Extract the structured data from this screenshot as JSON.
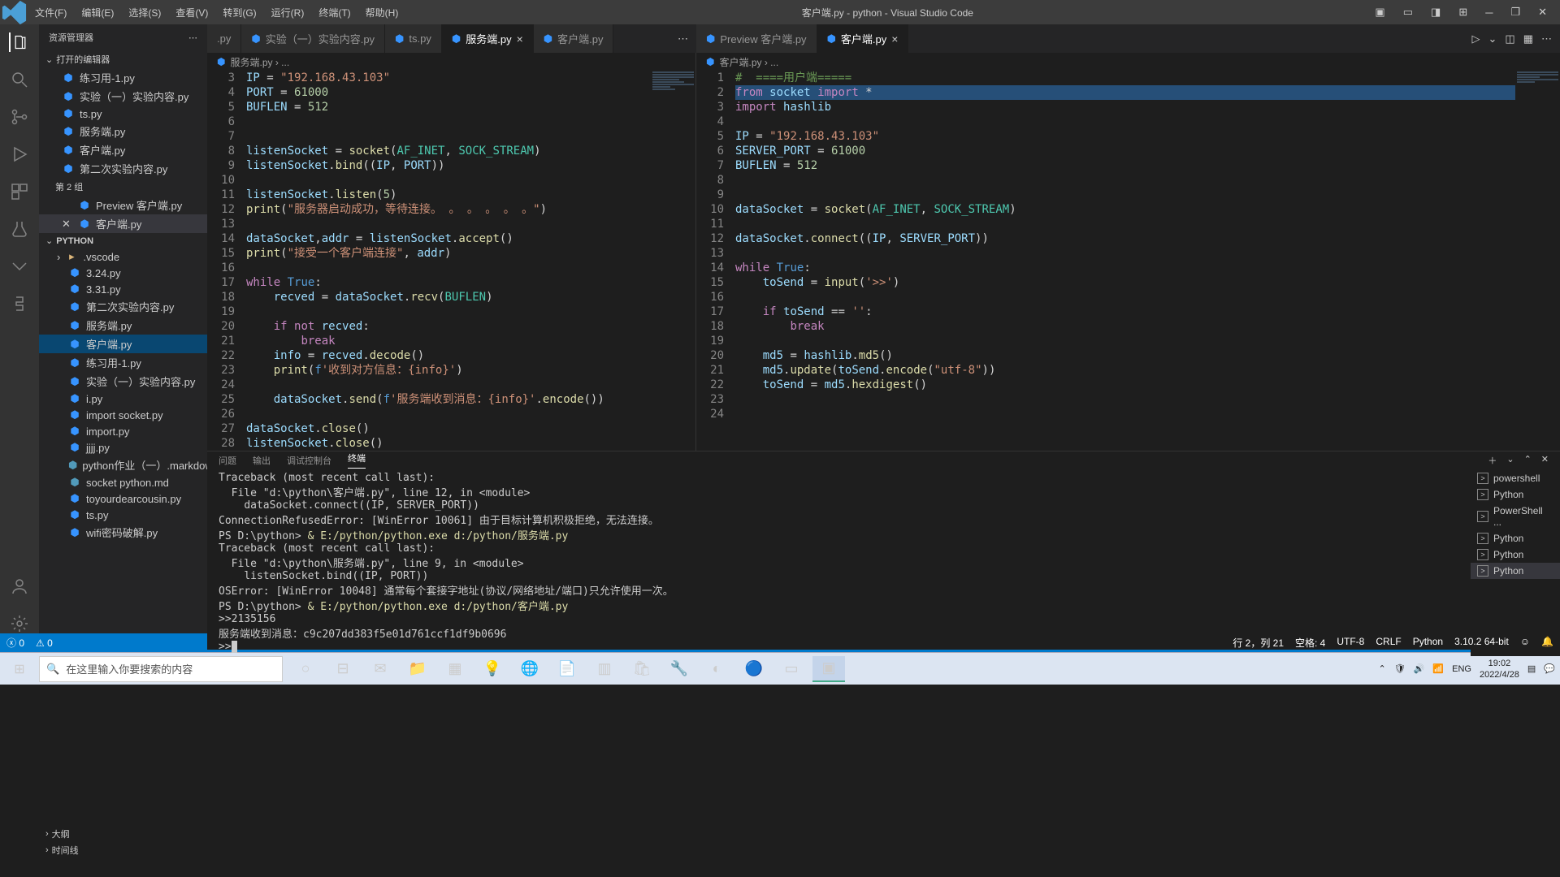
{
  "title": "客户端.py - python - Visual Studio Code",
  "menus": [
    "文件(F)",
    "编辑(E)",
    "选择(S)",
    "查看(V)",
    "转到(G)",
    "运行(R)",
    "终端(T)",
    "帮助(H)"
  ],
  "sidebar": {
    "title": "资源管理器",
    "openEditors": "打开的编辑器",
    "group2": "第 2 组",
    "pythonFolder": "PYTHON",
    "items": [
      {
        "label": "练习用-1.py",
        "active": false
      },
      {
        "label": "实验（一）实验内容.py",
        "active": false
      },
      {
        "label": "ts.py",
        "active": false
      },
      {
        "label": "服务端.py",
        "active": false
      },
      {
        "label": "客户端.py",
        "active": false
      },
      {
        "label": "第二次实验内容.py",
        "active": false
      }
    ],
    "group2items": [
      {
        "label": "Preview 客户端.py",
        "close": false
      },
      {
        "label": "客户端.py",
        "close": true,
        "active": true
      }
    ],
    "files": [
      ".vscode",
      "3.24.py",
      "3.31.py",
      "第二次实验内容.py",
      "服务端.py",
      "客户端.py",
      "练习用-1.py",
      "实验（一）实验内容.py",
      "i.py",
      "import socket.py",
      "import.py",
      "jjjj.py",
      "python作业（一）.markdown",
      "socket python.md",
      "toyourdearcousin.py",
      "ts.py",
      "wifi密码破解.py"
    ],
    "outline": "大纲",
    "timeline": "时间线"
  },
  "tabsLeft": [
    {
      "label": ".py",
      "dot": false,
      "active": false
    },
    {
      "label": "实验（一）实验内容.py",
      "dot": true,
      "active": false
    },
    {
      "label": "ts.py",
      "dot": true,
      "active": false
    },
    {
      "label": "服务端.py",
      "dot": true,
      "active": true,
      "close": true
    },
    {
      "label": "客户端.py",
      "dot": true,
      "active": false
    }
  ],
  "tabsRight": [
    {
      "label": "Preview 客户端.py",
      "dot": true,
      "active": false
    },
    {
      "label": "客户端.py",
      "dot": true,
      "active": true,
      "close": true
    }
  ],
  "breadcrumbLeft": "服务端.py › ...",
  "breadcrumbRight": "客户端.py › ...",
  "codeLeft": {
    "start": 3,
    "lines": [
      [
        [
          "var",
          "IP"
        ],
        [
          "op",
          " = "
        ],
        [
          "str",
          "\"192.168.43.103\""
        ]
      ],
      [
        [
          "var",
          "PORT"
        ],
        [
          "op",
          " = "
        ],
        [
          "num",
          "61000"
        ]
      ],
      [
        [
          "var",
          "BUFLEN"
        ],
        [
          "op",
          " = "
        ],
        [
          "num",
          "512"
        ]
      ],
      [],
      [],
      [
        [
          "var",
          "listenSocket"
        ],
        [
          "op",
          " = "
        ],
        [
          "fn",
          "socket"
        ],
        [
          "op",
          "("
        ],
        [
          "cls",
          "AF_INET"
        ],
        [
          "op",
          ", "
        ],
        [
          "cls",
          "SOCK_STREAM"
        ],
        [
          "op",
          ")"
        ]
      ],
      [
        [
          "var",
          "listenSocket"
        ],
        [
          "op",
          "."
        ],
        [
          "fn",
          "bind"
        ],
        [
          "op",
          "(("
        ],
        [
          "var",
          "IP"
        ],
        [
          "op",
          ", "
        ],
        [
          "var",
          "PORT"
        ],
        [
          "op",
          "))"
        ]
      ],
      [],
      [
        [
          "var",
          "listenSocket"
        ],
        [
          "op",
          "."
        ],
        [
          "fn",
          "listen"
        ],
        [
          "op",
          "("
        ],
        [
          "num",
          "5"
        ],
        [
          "op",
          ")"
        ]
      ],
      [
        [
          "fn",
          "print"
        ],
        [
          "op",
          "("
        ],
        [
          "str",
          "\"服务器启动成功，等待连接。 。 。 。 。 。\""
        ],
        [
          "op",
          ")"
        ]
      ],
      [],
      [
        [
          "var",
          "dataSocket"
        ],
        [
          "op",
          ","
        ],
        [
          "var",
          "addr"
        ],
        [
          "op",
          " = "
        ],
        [
          "var",
          "listenSocket"
        ],
        [
          "op",
          "."
        ],
        [
          "fn",
          "accept"
        ],
        [
          "op",
          "()"
        ]
      ],
      [
        [
          "fn",
          "print"
        ],
        [
          "op",
          "("
        ],
        [
          "str",
          "\"接受一个客户端连接\""
        ],
        [
          "op",
          ", "
        ],
        [
          "var",
          "addr"
        ],
        [
          "op",
          ")"
        ]
      ],
      [],
      [
        [
          "kw",
          "while"
        ],
        [
          "op",
          " "
        ],
        [
          "const",
          "True"
        ],
        [
          "op",
          ":"
        ]
      ],
      [
        [
          "op",
          "    "
        ],
        [
          "var",
          "recved"
        ],
        [
          "op",
          " = "
        ],
        [
          "var",
          "dataSocket"
        ],
        [
          "op",
          "."
        ],
        [
          "fn",
          "recv"
        ],
        [
          "op",
          "("
        ],
        [
          "cls",
          "BUFLEN"
        ],
        [
          "op",
          ")"
        ]
      ],
      [],
      [
        [
          "op",
          "    "
        ],
        [
          "kw",
          "if"
        ],
        [
          "op",
          " "
        ],
        [
          "kw",
          "not"
        ],
        [
          "op",
          " "
        ],
        [
          "var",
          "recved"
        ],
        [
          "op",
          ":"
        ]
      ],
      [
        [
          "op",
          "        "
        ],
        [
          "kw",
          "break"
        ]
      ],
      [
        [
          "op",
          "    "
        ],
        [
          "var",
          "info"
        ],
        [
          "op",
          " = "
        ],
        [
          "var",
          "recved"
        ],
        [
          "op",
          "."
        ],
        [
          "fn",
          "decode"
        ],
        [
          "op",
          "()"
        ]
      ],
      [
        [
          "op",
          "    "
        ],
        [
          "fn",
          "print"
        ],
        [
          "op",
          "("
        ],
        [
          "const",
          "f"
        ],
        [
          "str",
          "'收到对方信息：{info}'"
        ],
        [
          "op",
          ")"
        ]
      ],
      [],
      [
        [
          "op",
          "    "
        ],
        [
          "var",
          "dataSocket"
        ],
        [
          "op",
          "."
        ],
        [
          "fn",
          "send"
        ],
        [
          "op",
          "("
        ],
        [
          "const",
          "f"
        ],
        [
          "str",
          "'服务端收到消息：{info}'"
        ],
        [
          "op",
          "."
        ],
        [
          "fn",
          "encode"
        ],
        [
          "op",
          "())"
        ]
      ],
      [],
      [
        [
          "var",
          "dataSocket"
        ],
        [
          "op",
          "."
        ],
        [
          "fn",
          "close"
        ],
        [
          "op",
          "()"
        ]
      ],
      [
        [
          "var",
          "listenSocket"
        ],
        [
          "op",
          "."
        ],
        [
          "fn",
          "close"
        ],
        [
          "op",
          "()"
        ]
      ]
    ]
  },
  "codeRight": {
    "start": 1,
    "lines": [
      [
        [
          "com",
          "#  ====用户端====="
        ]
      ],
      [
        [
          "kw",
          "from"
        ],
        [
          "op",
          " "
        ],
        [
          "var",
          "socket"
        ],
        [
          "op",
          " "
        ],
        [
          "kw",
          "import"
        ],
        [
          "op",
          " *"
        ]
      ],
      [
        [
          "kw",
          "import"
        ],
        [
          "op",
          " "
        ],
        [
          "var",
          "hashlib"
        ]
      ],
      [],
      [
        [
          "var",
          "IP"
        ],
        [
          "op",
          " = "
        ],
        [
          "str",
          "\"192.168.43.103\""
        ]
      ],
      [
        [
          "var",
          "SERVER_PORT"
        ],
        [
          "op",
          " = "
        ],
        [
          "num",
          "61000"
        ]
      ],
      [
        [
          "var",
          "BUFLEN"
        ],
        [
          "op",
          " = "
        ],
        [
          "num",
          "512"
        ]
      ],
      [],
      [],
      [
        [
          "var",
          "dataSocket"
        ],
        [
          "op",
          " = "
        ],
        [
          "fn",
          "socket"
        ],
        [
          "op",
          "("
        ],
        [
          "cls",
          "AF_INET"
        ],
        [
          "op",
          ", "
        ],
        [
          "cls",
          "SOCK_STREAM"
        ],
        [
          "op",
          ")"
        ]
      ],
      [],
      [
        [
          "var",
          "dataSocket"
        ],
        [
          "op",
          "."
        ],
        [
          "fn",
          "connect"
        ],
        [
          "op",
          "(("
        ],
        [
          "var",
          "IP"
        ],
        [
          "op",
          ", "
        ],
        [
          "var",
          "SERVER_PORT"
        ],
        [
          "op",
          "))"
        ]
      ],
      [],
      [
        [
          "kw",
          "while"
        ],
        [
          "op",
          " "
        ],
        [
          "const",
          "True"
        ],
        [
          "op",
          ":"
        ]
      ],
      [
        [
          "op",
          "    "
        ],
        [
          "var",
          "toSend"
        ],
        [
          "op",
          " = "
        ],
        [
          "fn",
          "input"
        ],
        [
          "op",
          "("
        ],
        [
          "str",
          "'>>'"
        ],
        [
          "op",
          ")"
        ]
      ],
      [],
      [
        [
          "op",
          "    "
        ],
        [
          "kw",
          "if"
        ],
        [
          "op",
          " "
        ],
        [
          "var",
          "toSend"
        ],
        [
          "op",
          " == "
        ],
        [
          "str",
          "''"
        ],
        [
          "op",
          ":"
        ]
      ],
      [
        [
          "op",
          "        "
        ],
        [
          "kw",
          "break"
        ]
      ],
      [],
      [
        [
          "op",
          "    "
        ],
        [
          "var",
          "md5"
        ],
        [
          "op",
          " = "
        ],
        [
          "var",
          "hashlib"
        ],
        [
          "op",
          "."
        ],
        [
          "fn",
          "md5"
        ],
        [
          "op",
          "()"
        ]
      ],
      [
        [
          "op",
          "    "
        ],
        [
          "var",
          "md5"
        ],
        [
          "op",
          "."
        ],
        [
          "fn",
          "update"
        ],
        [
          "op",
          "("
        ],
        [
          "var",
          "toSend"
        ],
        [
          "op",
          "."
        ],
        [
          "fn",
          "encode"
        ],
        [
          "op",
          "("
        ],
        [
          "str",
          "\"utf-8\""
        ],
        [
          "op",
          "))"
        ]
      ],
      [
        [
          "op",
          "    "
        ],
        [
          "var",
          "toSend"
        ],
        [
          "op",
          " = "
        ],
        [
          "var",
          "md5"
        ],
        [
          "op",
          "."
        ],
        [
          "fn",
          "hexdigest"
        ],
        [
          "op",
          "()"
        ]
      ],
      [],
      []
    ],
    "highlightLine": 2
  },
  "panelTabs": [
    "问题",
    "输出",
    "调试控制台",
    "终端"
  ],
  "panelActive": 3,
  "terminal": [
    {
      "t": "Traceback (most recent call last):"
    },
    {
      "t": "  File \"d:\\python\\客户端.py\", line 12, in <module>"
    },
    {
      "t": "    dataSocket.connect((IP, SERVER_PORT))"
    },
    {
      "t": "ConnectionRefusedError: [WinError 10061] 由于目标计算机积极拒绝，无法连接。"
    },
    {
      "prompt": "PS D:\\python> ",
      "cmd": "& E:/python/python.exe d:/python/服务端.py"
    },
    {
      "t": "Traceback (most recent call last):"
    },
    {
      "t": "  File \"d:\\python\\服务端.py\", line 9, in <module>"
    },
    {
      "t": "    listenSocket.bind((IP, PORT))"
    },
    {
      "t": "OSError: [WinError 10048] 通常每个套接字地址(协议/网络地址/端口)只允许使用一次。"
    },
    {
      "prompt": "PS D:\\python> ",
      "cmd": "& E:/python/python.exe d:/python/客户端.py"
    },
    {
      "t": ">>2135156"
    },
    {
      "t": "服务端收到消息：c9c207dd383f5e01d761ccf1df9b0696"
    },
    {
      "t": ">>",
      "cursor": true
    }
  ],
  "termList": [
    "powershell",
    "Python",
    "PowerShell ...",
    "Python",
    "Python",
    "Python"
  ],
  "statusbar": {
    "errors": "0",
    "warnings": "0",
    "position": "行 2，列 21",
    "spaces": "空格: 4",
    "encoding": "UTF-8",
    "eol": "CRLF",
    "lang": "Python",
    "pyver": "3.10.2 64-bit"
  },
  "taskbar": {
    "searchPlaceholder": "在这里输入你要搜索的内容",
    "lang": "ENG",
    "time": "19:02",
    "date": "2022/4/28"
  }
}
